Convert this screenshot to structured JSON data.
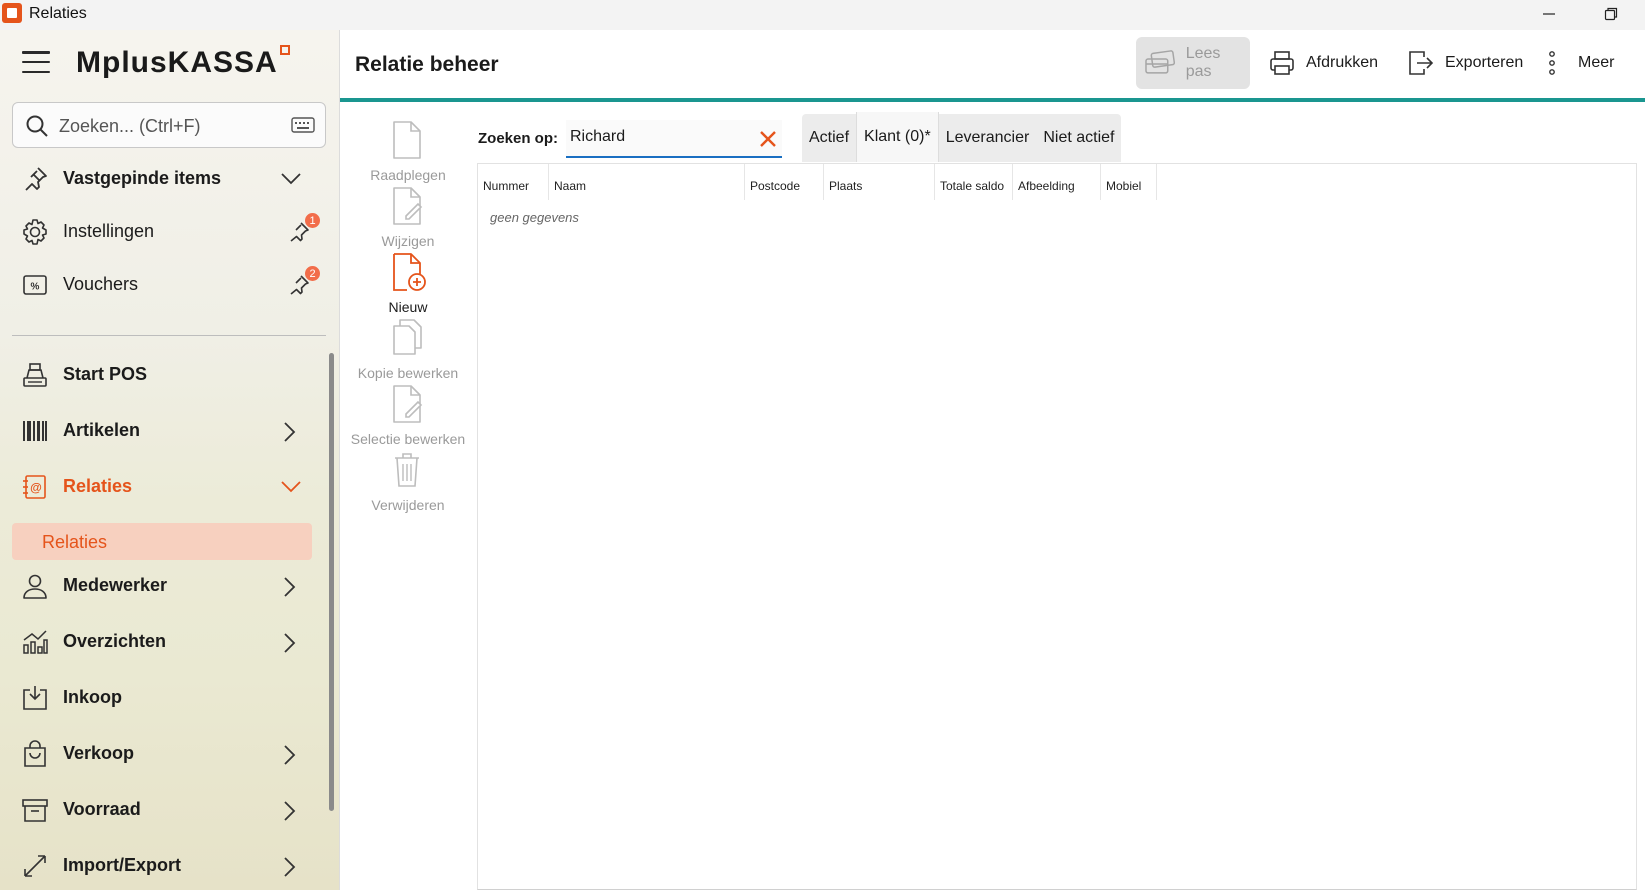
{
  "window": {
    "title": "Relaties"
  },
  "sidebar": {
    "logo": "MplusKASSA",
    "search": {
      "placeholder": "Zoeken... (Ctrl+F)"
    },
    "pinned_header": "Vastgepinde items",
    "pinned": [
      {
        "label": "Instellingen",
        "badge": "1"
      },
      {
        "label": "Vouchers",
        "badge": "2"
      }
    ],
    "items": [
      {
        "label": "Start POS"
      },
      {
        "label": "Artikelen"
      },
      {
        "label": "Relaties"
      },
      {
        "label": "Medewerker"
      },
      {
        "label": "Overzichten"
      },
      {
        "label": "Inkoop"
      },
      {
        "label": "Verkoop"
      },
      {
        "label": "Voorraad"
      },
      {
        "label": "Import/Export"
      }
    ],
    "sub_items": [
      {
        "label": "Relaties"
      }
    ]
  },
  "header": {
    "title": "Relatie beheer",
    "toolbar": {
      "lees_pas": "Lees pas",
      "afdrukken": "Afdrukken",
      "exporteren": "Exporteren",
      "meer": "Meer"
    }
  },
  "actions": [
    {
      "label": "Raadplegen",
      "icon": "document-icon",
      "enabled": false
    },
    {
      "label": "Wijzigen",
      "icon": "edit-document-icon",
      "enabled": false
    },
    {
      "label": "Nieuw",
      "icon": "new-document-icon",
      "enabled": true
    },
    {
      "label": "Kopie bewerken",
      "icon": "copy-icon",
      "enabled": false
    },
    {
      "label": "Selectie bewerken",
      "icon": "edit-document-icon",
      "enabled": false
    },
    {
      "label": "Verwijderen",
      "icon": "trash-icon",
      "enabled": false
    }
  ],
  "search": {
    "label": "Zoeken op:",
    "value": "Richard"
  },
  "tabs": [
    {
      "label": "Actief"
    },
    {
      "label": "Klant (0)*",
      "selected": true
    },
    {
      "label": "Leverancier"
    },
    {
      "label": "Niet actief"
    }
  ],
  "table": {
    "columns": [
      "Nummer",
      "Naam",
      "Postcode",
      "Plaats",
      "Totale saldo",
      "Afbeelding",
      "Mobiel"
    ],
    "rows": [],
    "empty_text": "geen gegevens"
  },
  "colors": {
    "accent": "#e5541b",
    "teal": "#1a9690",
    "focus": "#1a6fc2"
  }
}
